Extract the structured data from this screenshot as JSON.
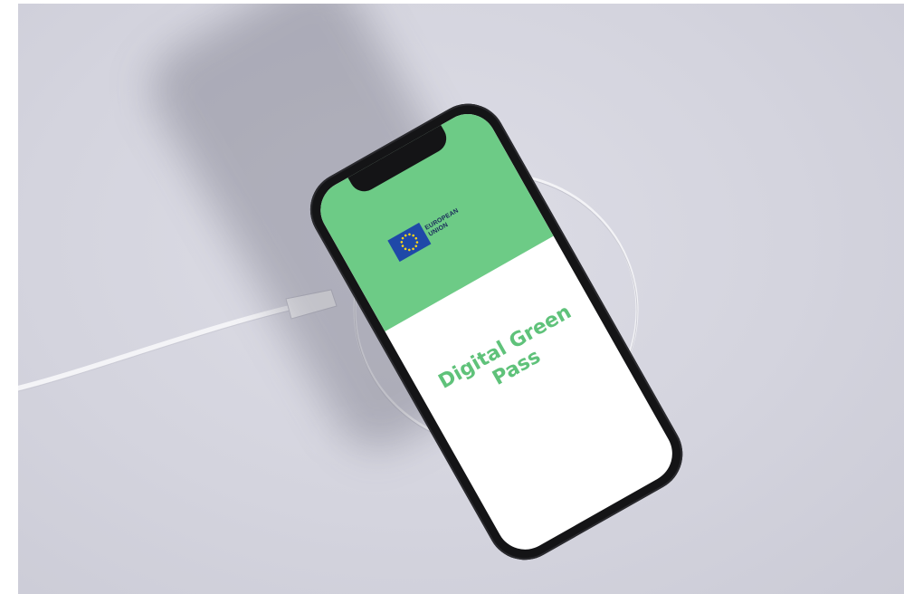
{
  "screen": {
    "logo_line1": "EUROPEAN",
    "logo_line2": "UNION",
    "title_line1": "Digital Green",
    "title_line2": "Pass",
    "header_color": "#6dcb86",
    "title_color": "#5fc27a",
    "flag_color": "#1f49a8",
    "star_color": "#ffd617"
  },
  "objects": {
    "phone": "smartphone",
    "charger": "wireless-charging-pad",
    "cable": "white-usb-cable"
  }
}
